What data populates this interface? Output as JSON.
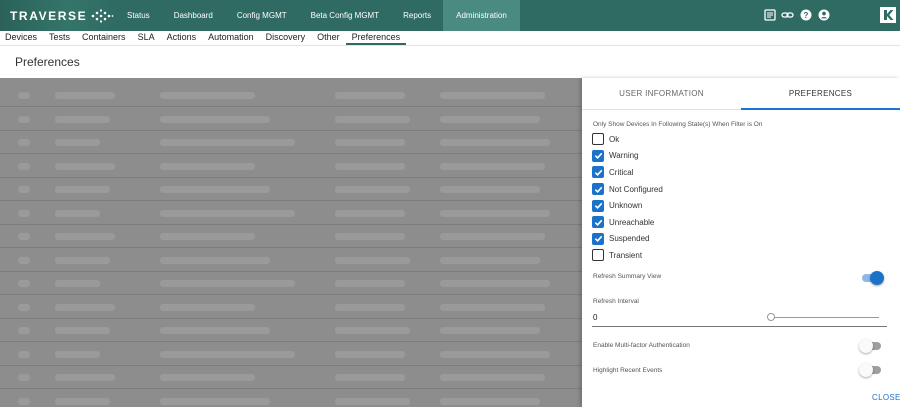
{
  "app": {
    "logo_text": "TRAVERSE",
    "nav": [
      "Status",
      "Dashboard",
      "Config MGMT",
      "Beta Config MGMT",
      "Reports",
      "Administration"
    ],
    "active_nav": "Administration",
    "top_icons": [
      "notes-icon",
      "link-icon",
      "help-icon",
      "user-icon"
    ],
    "brand_letter": "K",
    "header_color": "#2f6b63"
  },
  "subnav": {
    "items": [
      "Devices",
      "Tests",
      "Containers",
      "SLA",
      "Actions",
      "Automation",
      "Discovery",
      "Other",
      "Preferences"
    ],
    "active": "Preferences"
  },
  "page": {
    "title": "Preferences"
  },
  "panel": {
    "tabs": [
      "USER INFORMATION",
      "PREFERENCES"
    ],
    "active_tab": "PREFERENCES",
    "filter_label": "Only Show Devices In Following State(s) When Filter is On",
    "states": [
      {
        "label": "Ok",
        "checked": false
      },
      {
        "label": "Warning",
        "checked": true
      },
      {
        "label": "Critical",
        "checked": true
      },
      {
        "label": "Not Configured",
        "checked": true
      },
      {
        "label": "Unknown",
        "checked": true
      },
      {
        "label": "Unreachable",
        "checked": true
      },
      {
        "label": "Suspended",
        "checked": true
      },
      {
        "label": "Transient",
        "checked": false
      }
    ],
    "refresh_summary": {
      "label": "Refresh Summary View",
      "on": true
    },
    "refresh_interval": {
      "label": "Refresh Interval",
      "value": "0"
    },
    "mfa": {
      "label": "Enable Multi-factor Authentication",
      "on": false
    },
    "highlight": {
      "label": "Highlight Recent Events",
      "on": false
    },
    "close_label": "CLOSE",
    "accent": "#1a73c8"
  }
}
